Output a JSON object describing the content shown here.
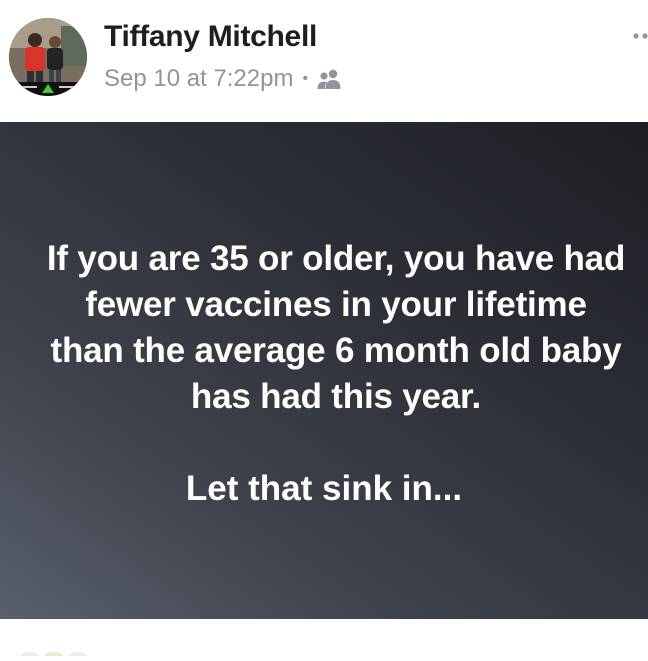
{
  "post": {
    "author": "Tiffany Mitchell",
    "timestamp": "Sep 10 at 7:22pm",
    "separator": "•",
    "audience_icon": "friends-icon",
    "body_lines": [
      "If you are 35 or older, you have had",
      "fewer vaccines in your lifetime",
      "than the average 6 month old baby",
      "has had this year."
    ],
    "closing_line": "Let that sink in...",
    "background_colors": [
      "#1d1f24",
      "#5a5f6d"
    ]
  },
  "colors": {
    "author_text": "#1c1e21",
    "meta_text": "#90949c",
    "post_text": "#ffffff"
  }
}
